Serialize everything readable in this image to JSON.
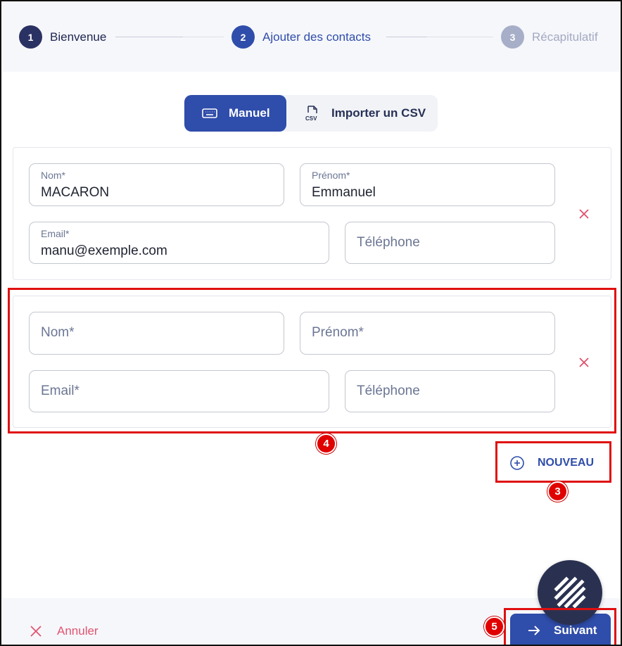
{
  "stepper": {
    "steps": [
      {
        "num": "1",
        "label": "Bienvenue"
      },
      {
        "num": "2",
        "label": "Ajouter des contacts"
      },
      {
        "num": "3",
        "label": "Récapitulatif"
      }
    ]
  },
  "mode_toggle": {
    "manual_label": "Manuel",
    "csv_label": "Importer un CSV",
    "manual_icon": "keyboard-icon",
    "csv_icon": "csv-file-icon",
    "selected": "Manuel"
  },
  "contacts": [
    {
      "nom": {
        "label": "Nom*",
        "value": "MACARON"
      },
      "prenom": {
        "label": "Prénom*",
        "value": "Emmanuel"
      },
      "email": {
        "label": "Email*",
        "value": "manu@exemple.com"
      },
      "telephone": {
        "placeholder": "Téléphone"
      }
    },
    {
      "nom": {
        "placeholder": "Nom*"
      },
      "prenom": {
        "placeholder": "Prénom*"
      },
      "email": {
        "placeholder": "Email*"
      },
      "telephone": {
        "placeholder": "Téléphone"
      }
    }
  ],
  "actions": {
    "new_label": "NOUVEAU",
    "cancel_label": "Annuler",
    "next_label": "Suivant"
  },
  "annotations": [
    "4",
    "3",
    "5"
  ],
  "colors": {
    "primary": "#2f4daa",
    "dark": "#2a3163",
    "danger": "#e05470",
    "highlight": "#e01010"
  }
}
